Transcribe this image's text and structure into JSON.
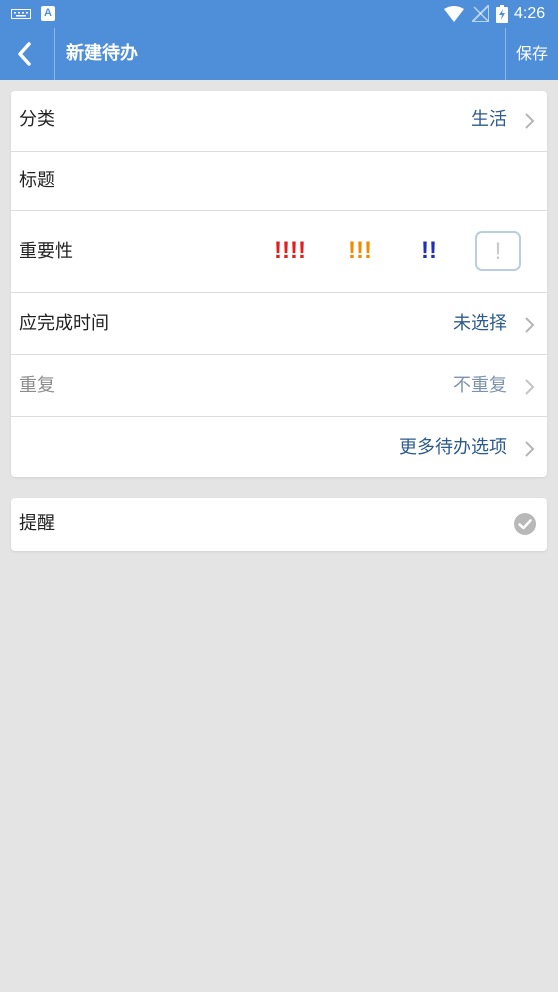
{
  "status_bar": {
    "time": "4:26",
    "icons": [
      "keyboard-icon",
      "a-badge-icon",
      "wifi-icon",
      "no-signal-icon",
      "battery-charging-icon"
    ]
  },
  "app_bar": {
    "title": "新建待办",
    "save_label": "保存",
    "back_icon": "chevron-left-icon"
  },
  "form": {
    "category": {
      "label": "分类",
      "value": "生活"
    },
    "title": {
      "label": "标题"
    },
    "importance": {
      "label": "重要性",
      "options": [
        {
          "marks": "!!!!",
          "color": "#e02020"
        },
        {
          "marks": "!!!",
          "color": "#f08c00"
        },
        {
          "marks": "!!",
          "color": "#1f2fb8"
        },
        {
          "marks": "!",
          "color": "#c9c9c9",
          "selected": true
        }
      ]
    },
    "due_time": {
      "label": "应完成时间",
      "value": "未选择"
    },
    "repeat": {
      "label": "重复",
      "value": "不重复"
    },
    "more": {
      "label": "更多待办选项"
    }
  },
  "reminder": {
    "label": "提醒",
    "checked": true
  },
  "colors": {
    "primary": "#4f8fd9",
    "background": "#e4e4e4",
    "value_text": "#2c5b8c"
  }
}
